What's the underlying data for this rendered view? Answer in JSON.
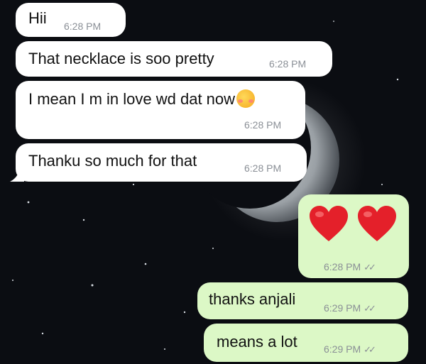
{
  "messages": [
    {
      "direction": "incoming",
      "text": "Hii",
      "time": "6:28 PM"
    },
    {
      "direction": "incoming",
      "text": "That necklace is soo pretty",
      "time": "6:28 PM"
    },
    {
      "direction": "incoming",
      "text": "I mean I m in love wd dat now",
      "emoji": "smiling-face-with-hearts-icon",
      "time": "6:28 PM"
    },
    {
      "direction": "incoming",
      "text": "Thanku so much for that",
      "time": "6:28 PM"
    },
    {
      "direction": "outgoing",
      "emoji": "red-heart-icon x2",
      "time": "6:28 PM",
      "status": "read"
    },
    {
      "direction": "outgoing",
      "text": "thanks anjali",
      "time": "6:29 PM",
      "status": "read"
    },
    {
      "direction": "outgoing",
      "text": "means a lot",
      "time": "6:29 PM",
      "status": "read"
    }
  ],
  "colors": {
    "incoming_bubble": "#ffffff",
    "outgoing_bubble": "#dcf8c6",
    "wallpaper": "#0b0d12",
    "heart": "#e4202a"
  },
  "icons": {
    "read_receipt": "double-check-icon",
    "wallpaper": "crescent-moon-stars"
  }
}
